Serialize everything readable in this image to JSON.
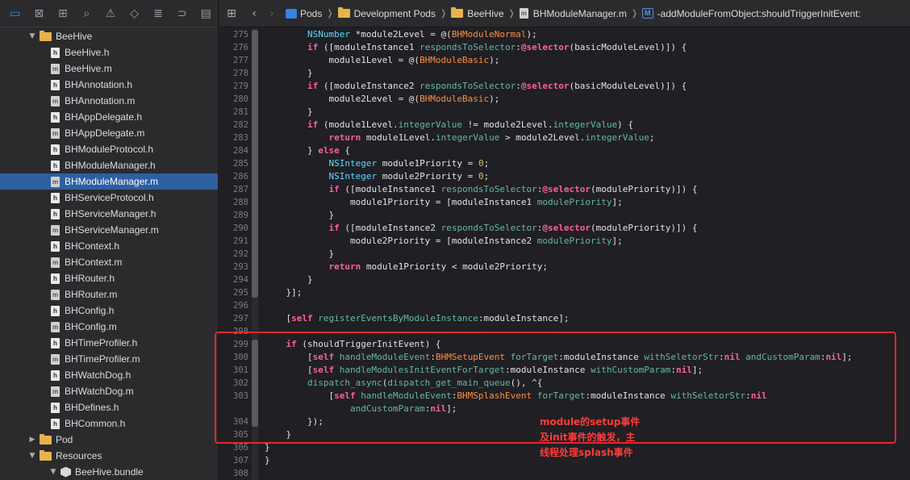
{
  "sidebar": {
    "toolbar_icons": [
      "folder-icon",
      "source-control-icon",
      "symbol-navigator-icon",
      "find-icon",
      "issue-icon",
      "test-icon",
      "debug-icon",
      "breakpoint-icon",
      "report-icon"
    ],
    "tree": [
      {
        "label": "BeeHive",
        "kind": "folder",
        "indent": 1,
        "expanded": true
      },
      {
        "label": "BeeHive.h",
        "kind": "h",
        "indent": 2
      },
      {
        "label": "BeeHive.m",
        "kind": "m",
        "indent": 2
      },
      {
        "label": "BHAnnotation.h",
        "kind": "h",
        "indent": 2
      },
      {
        "label": "BHAnnotation.m",
        "kind": "m",
        "indent": 2
      },
      {
        "label": "BHAppDelegate.h",
        "kind": "h",
        "indent": 2
      },
      {
        "label": "BHAppDelegate.m",
        "kind": "m",
        "indent": 2
      },
      {
        "label": "BHModuleProtocol.h",
        "kind": "h",
        "indent": 2
      },
      {
        "label": "BHModuleManager.h",
        "kind": "h",
        "indent": 2
      },
      {
        "label": "BHModuleManager.m",
        "kind": "m",
        "indent": 2,
        "selected": true
      },
      {
        "label": "BHServiceProtocol.h",
        "kind": "h",
        "indent": 2
      },
      {
        "label": "BHServiceManager.h",
        "kind": "h",
        "indent": 2
      },
      {
        "label": "BHServiceManager.m",
        "kind": "m",
        "indent": 2
      },
      {
        "label": "BHContext.h",
        "kind": "h",
        "indent": 2
      },
      {
        "label": "BHContext.m",
        "kind": "m",
        "indent": 2
      },
      {
        "label": "BHRouter.h",
        "kind": "h",
        "indent": 2
      },
      {
        "label": "BHRouter.m",
        "kind": "m",
        "indent": 2
      },
      {
        "label": "BHConfig.h",
        "kind": "h",
        "indent": 2
      },
      {
        "label": "BHConfig.m",
        "kind": "m",
        "indent": 2
      },
      {
        "label": "BHTimeProfiler.h",
        "kind": "h",
        "indent": 2
      },
      {
        "label": "BHTimeProfiler.m",
        "kind": "m",
        "indent": 2
      },
      {
        "label": "BHWatchDog.h",
        "kind": "h",
        "indent": 2
      },
      {
        "label": "BHWatchDog.m",
        "kind": "m",
        "indent": 2
      },
      {
        "label": "BHDefines.h",
        "kind": "h",
        "indent": 2
      },
      {
        "label": "BHCommon.h",
        "kind": "h",
        "indent": 2
      },
      {
        "label": "Pod",
        "kind": "folder",
        "indent": 1,
        "expanded": false
      },
      {
        "label": "Resources",
        "kind": "folder",
        "indent": 1,
        "expanded": true
      },
      {
        "label": "BeeHive.bundle",
        "kind": "bundle",
        "indent": 2,
        "expanded": true
      }
    ]
  },
  "jumpbar": {
    "crumbs": [
      "Pods",
      "Development Pods",
      "BeeHive",
      "BHModuleManager.m",
      "-addModuleFromObject:shouldTriggerInitEvent:"
    ],
    "method_badge": "M"
  },
  "code_lines": [
    {
      "n": "275",
      "t": [
        [
          "pl",
          "        "
        ],
        [
          "ty",
          "NSNumber"
        ],
        [
          "pl",
          " *module2Level = @("
        ],
        [
          "ma",
          "BHModuleNormal"
        ],
        [
          "pl",
          ");"
        ]
      ]
    },
    {
      "n": "276",
      "t": [
        [
          "pl",
          "        "
        ],
        [
          "kw",
          "if"
        ],
        [
          "pl",
          " ([moduleInstance1 "
        ],
        [
          "me",
          "respondsToSelector"
        ],
        [
          "pl",
          ":"
        ],
        [
          "kw",
          "@selector"
        ],
        [
          "pl",
          "(basicModuleLevel)]) {"
        ]
      ]
    },
    {
      "n": "277",
      "t": [
        [
          "pl",
          "            module1Level = @("
        ],
        [
          "ma",
          "BHModuleBasic"
        ],
        [
          "pl",
          ");"
        ]
      ]
    },
    {
      "n": "278",
      "t": [
        [
          "pl",
          "        }"
        ]
      ]
    },
    {
      "n": "279",
      "t": [
        [
          "pl",
          "        "
        ],
        [
          "kw",
          "if"
        ],
        [
          "pl",
          " ([moduleInstance2 "
        ],
        [
          "me",
          "respondsToSelector"
        ],
        [
          "pl",
          ":"
        ],
        [
          "kw",
          "@selector"
        ],
        [
          "pl",
          "(basicModuleLevel)]) {"
        ]
      ]
    },
    {
      "n": "280",
      "t": [
        [
          "pl",
          "            module2Level = @("
        ],
        [
          "ma",
          "BHModuleBasic"
        ],
        [
          "pl",
          ");"
        ]
      ]
    },
    {
      "n": "281",
      "t": [
        [
          "pl",
          "        }"
        ]
      ]
    },
    {
      "n": "282",
      "t": [
        [
          "pl",
          "        "
        ],
        [
          "kw",
          "if"
        ],
        [
          "pl",
          " (module1Level."
        ],
        [
          "me",
          "integerValue"
        ],
        [
          "pl",
          " != module2Level."
        ],
        [
          "me",
          "integerValue"
        ],
        [
          "pl",
          ") {"
        ]
      ]
    },
    {
      "n": "283",
      "t": [
        [
          "pl",
          "            "
        ],
        [
          "kw",
          "return"
        ],
        [
          "pl",
          " module1Level."
        ],
        [
          "me",
          "integerValue"
        ],
        [
          "pl",
          " > module2Level."
        ],
        [
          "me",
          "integerValue"
        ],
        [
          "pl",
          ";"
        ]
      ]
    },
    {
      "n": "284",
      "t": [
        [
          "pl",
          "        } "
        ],
        [
          "kw",
          "else"
        ],
        [
          "pl",
          " {"
        ]
      ]
    },
    {
      "n": "285",
      "t": [
        [
          "pl",
          "            "
        ],
        [
          "ty",
          "NSInteger"
        ],
        [
          "pl",
          " module1Priority = "
        ],
        [
          "nu",
          "0"
        ],
        [
          "pl",
          ";"
        ]
      ]
    },
    {
      "n": "286",
      "t": [
        [
          "pl",
          "            "
        ],
        [
          "ty",
          "NSInteger"
        ],
        [
          "pl",
          " module2Priority = "
        ],
        [
          "nu",
          "0"
        ],
        [
          "pl",
          ";"
        ]
      ]
    },
    {
      "n": "287",
      "t": [
        [
          "pl",
          "            "
        ],
        [
          "kw",
          "if"
        ],
        [
          "pl",
          " ([moduleInstance1 "
        ],
        [
          "me",
          "respondsToSelector"
        ],
        [
          "pl",
          ":"
        ],
        [
          "kw",
          "@selector"
        ],
        [
          "pl",
          "(modulePriority)]) {"
        ]
      ]
    },
    {
      "n": "288",
      "t": [
        [
          "pl",
          "                module1Priority = [moduleInstance1 "
        ],
        [
          "me",
          "modulePriority"
        ],
        [
          "pl",
          "];"
        ]
      ]
    },
    {
      "n": "289",
      "t": [
        [
          "pl",
          "            }"
        ]
      ]
    },
    {
      "n": "290",
      "t": [
        [
          "pl",
          "            "
        ],
        [
          "kw",
          "if"
        ],
        [
          "pl",
          " ([moduleInstance2 "
        ],
        [
          "me",
          "respondsToSelector"
        ],
        [
          "pl",
          ":"
        ],
        [
          "kw",
          "@selector"
        ],
        [
          "pl",
          "(modulePriority)]) {"
        ]
      ]
    },
    {
      "n": "291",
      "t": [
        [
          "pl",
          "                module2Priority = [moduleInstance2 "
        ],
        [
          "me",
          "modulePriority"
        ],
        [
          "pl",
          "];"
        ]
      ]
    },
    {
      "n": "292",
      "t": [
        [
          "pl",
          "            }"
        ]
      ]
    },
    {
      "n": "293",
      "t": [
        [
          "pl",
          "            "
        ],
        [
          "kw",
          "return"
        ],
        [
          "pl",
          " module1Priority < module2Priority;"
        ]
      ]
    },
    {
      "n": "294",
      "t": [
        [
          "pl",
          "        }"
        ]
      ]
    },
    {
      "n": "295",
      "t": [
        [
          "pl",
          "    }];"
        ]
      ]
    },
    {
      "n": "296",
      "t": [
        [
          "pl",
          ""
        ]
      ]
    },
    {
      "n": "297",
      "t": [
        [
          "pl",
          "    ["
        ],
        [
          "kw",
          "self"
        ],
        [
          "pl",
          " "
        ],
        [
          "me",
          "registerEventsByModuleInstance"
        ],
        [
          "pl",
          ":moduleInstance];"
        ]
      ]
    },
    {
      "n": "298",
      "t": [
        [
          "pl",
          ""
        ]
      ]
    },
    {
      "n": "299",
      "t": [
        [
          "pl",
          "    "
        ],
        [
          "kw",
          "if"
        ],
        [
          "pl",
          " (shouldTriggerInitEvent) {"
        ]
      ]
    },
    {
      "n": "300",
      "t": [
        [
          "pl",
          "        ["
        ],
        [
          "kw",
          "self"
        ],
        [
          "pl",
          " "
        ],
        [
          "me",
          "handleModuleEvent"
        ],
        [
          "pl",
          ":"
        ],
        [
          "ma",
          "BHMSetupEvent"
        ],
        [
          "pl",
          " "
        ],
        [
          "me",
          "forTarget"
        ],
        [
          "pl",
          ":moduleInstance "
        ],
        [
          "me",
          "withSeletorStr"
        ],
        [
          "pl",
          ":"
        ],
        [
          "kw",
          "nil"
        ],
        [
          "pl",
          " "
        ],
        [
          "me",
          "andCustomParam"
        ],
        [
          "pl",
          ":"
        ],
        [
          "kw",
          "nil"
        ],
        [
          "pl",
          "];"
        ]
      ]
    },
    {
      "n": "301",
      "t": [
        [
          "pl",
          "        ["
        ],
        [
          "kw",
          "self"
        ],
        [
          "pl",
          " "
        ],
        [
          "me",
          "handleModulesInitEventForTarget"
        ],
        [
          "pl",
          ":moduleInstance "
        ],
        [
          "me",
          "withCustomParam"
        ],
        [
          "pl",
          ":"
        ],
        [
          "kw",
          "nil"
        ],
        [
          "pl",
          "];"
        ]
      ]
    },
    {
      "n": "302",
      "t": [
        [
          "pl",
          "        "
        ],
        [
          "me",
          "dispatch_async"
        ],
        [
          "pl",
          "("
        ],
        [
          "me",
          "dispatch_get_main_queue"
        ],
        [
          "pl",
          "(), ^{"
        ]
      ]
    },
    {
      "n": "303",
      "t": [
        [
          "pl",
          "            ["
        ],
        [
          "kw",
          "self"
        ],
        [
          "pl",
          " "
        ],
        [
          "me",
          "handleModuleEvent"
        ],
        [
          "pl",
          ":"
        ],
        [
          "ma",
          "BHMSplashEvent"
        ],
        [
          "pl",
          " "
        ],
        [
          "me",
          "forTarget"
        ],
        [
          "pl",
          ":moduleInstance "
        ],
        [
          "me",
          "withSeletorStr"
        ],
        [
          "pl",
          ":"
        ],
        [
          "kw",
          "nil"
        ]
      ]
    },
    {
      "n": "",
      "t": [
        [
          "pl",
          "                "
        ],
        [
          "me",
          "andCustomParam"
        ],
        [
          "pl",
          ":"
        ],
        [
          "kw",
          "nil"
        ],
        [
          "pl",
          "];"
        ]
      ]
    },
    {
      "n": "304",
      "t": [
        [
          "pl",
          "        });"
        ]
      ]
    },
    {
      "n": "305",
      "t": [
        [
          "pl",
          "    }"
        ]
      ]
    },
    {
      "n": "306",
      "t": [
        [
          "pl",
          "}"
        ]
      ]
    },
    {
      "n": "307",
      "t": [
        [
          "pl",
          "}"
        ]
      ]
    },
    {
      "n": "308",
      "t": [
        [
          "pl",
          ""
        ]
      ]
    }
  ],
  "annotation": {
    "lines": [
      "module的setup事件",
      "及init事件的触发，主",
      "线程处理splash事件"
    ]
  },
  "colors": {
    "keyword": "#fc5fa3",
    "type": "#5dd8ff",
    "method": "#67b7a4",
    "macro": "#fd8f3f",
    "number": "#d0bf69",
    "highlight_border": "#e8262a",
    "selection": "#2e5fa3"
  }
}
